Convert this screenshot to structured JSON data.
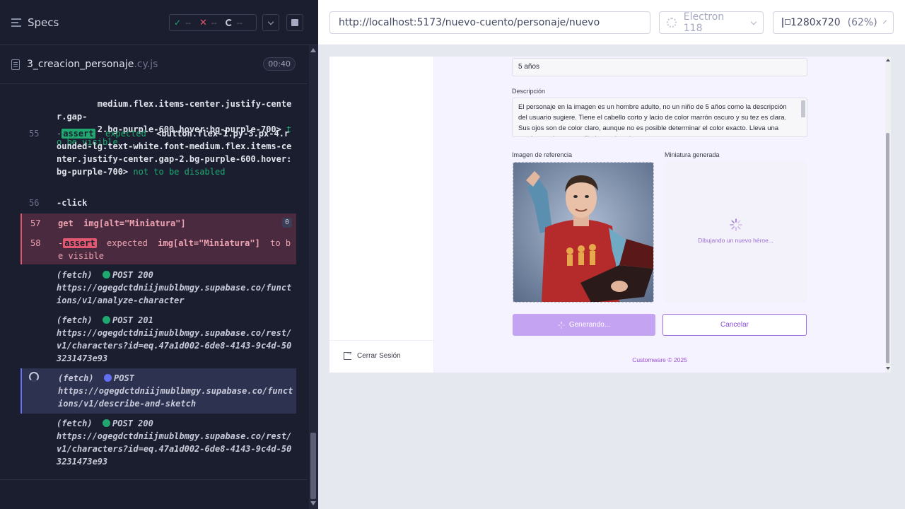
{
  "reporter": {
    "title": "Specs",
    "stats": {
      "passed": "--",
      "failed": "--",
      "pending": "--"
    },
    "spec_file": {
      "name": "3_creacion_personaje",
      "ext": ".cy.js",
      "duration": "00:40"
    },
    "commands": [
      {
        "num": "",
        "lines": [
          "medium.flex.items-center.justify-center.gap-",
          "2.bg-purple-600.hover:bg-purple-700>"
        ],
        "suffix": "to be visible"
      },
      {
        "num": "55",
        "badge": "assert",
        "keyword": "expected",
        "selector": "<button.flex-1.py-3.px-4.rounded-lg.text-white.font-medium.flex.items-center.justify-center.gap-2.bg-purple-600.hover:bg-purple-700>",
        "suffix": "not to be disabled"
      },
      {
        "num": "56",
        "text": "-click"
      },
      {
        "num": "57",
        "command": "get",
        "selector": "img[alt=\"Miniatura\"]",
        "count": "0"
      },
      {
        "num": "58",
        "badge": "assert",
        "keyword": "expected",
        "selector": "img[alt=\"Miniatura\"]",
        "suffix": "to be visible"
      },
      {
        "type": "(fetch)",
        "method": "POST 200",
        "url": "https://ogegdctdniijmublbmgy.supabase.co/functions/v1/analyze-character"
      },
      {
        "type": "(fetch)",
        "method": "POST 201",
        "url": "https://ogegdctdniijmublbmgy.supabase.co/rest/v1/characters?id=eq.47a1d002-6de8-4143-9c4d-503231473e93"
      },
      {
        "type": "(fetch)",
        "method": "POST",
        "url": "https://ogegdctdniijmublbmgy.supabase.co/functions/v1/describe-and-sketch"
      },
      {
        "type": "(fetch)",
        "method": "POST 200",
        "url": "https://ogegdctdniijmublbmgy.supabase.co/rest/v1/characters?id=eq.47a1d002-6de8-4143-9c4d-503231473e93"
      }
    ]
  },
  "browser": {
    "url": "http://localhost:5173/nuevo-cuento/personaje/nuevo",
    "browser_name": "Electron 118",
    "viewport": "1280x720",
    "zoom": "(62%)"
  },
  "app": {
    "age_value": "5 años",
    "description_label": "Descripción",
    "description_text": "El personaje en la imagen es un hombre adulto, no un niño de 5 años como la descripción del usuario sugiere. Tiene el cabello corto y lacio de color marrón oscuro y su tez es clara. Sus ojos son de color claro, aunque no es posible determinar el color exacto. Lleva una camiseta roja con un dibujo en el pecho y mangas a rayas.",
    "ref_image_label": "Imagen de referencia",
    "thumb_label": "Miniatura generada",
    "thumb_loading": "Dibujando un nuevo héroe...",
    "generate_button": "Generando...",
    "cancel_button": "Cancelar",
    "footer": "Customware © 2025",
    "logout": "Cerrar Sesión"
  },
  "colors": {
    "reporter_bg": "#1b1e2e",
    "pass": "#1fa971",
    "fail": "#e45770",
    "pending": "#6470f3",
    "brand_purple": "#9b4fd4"
  }
}
